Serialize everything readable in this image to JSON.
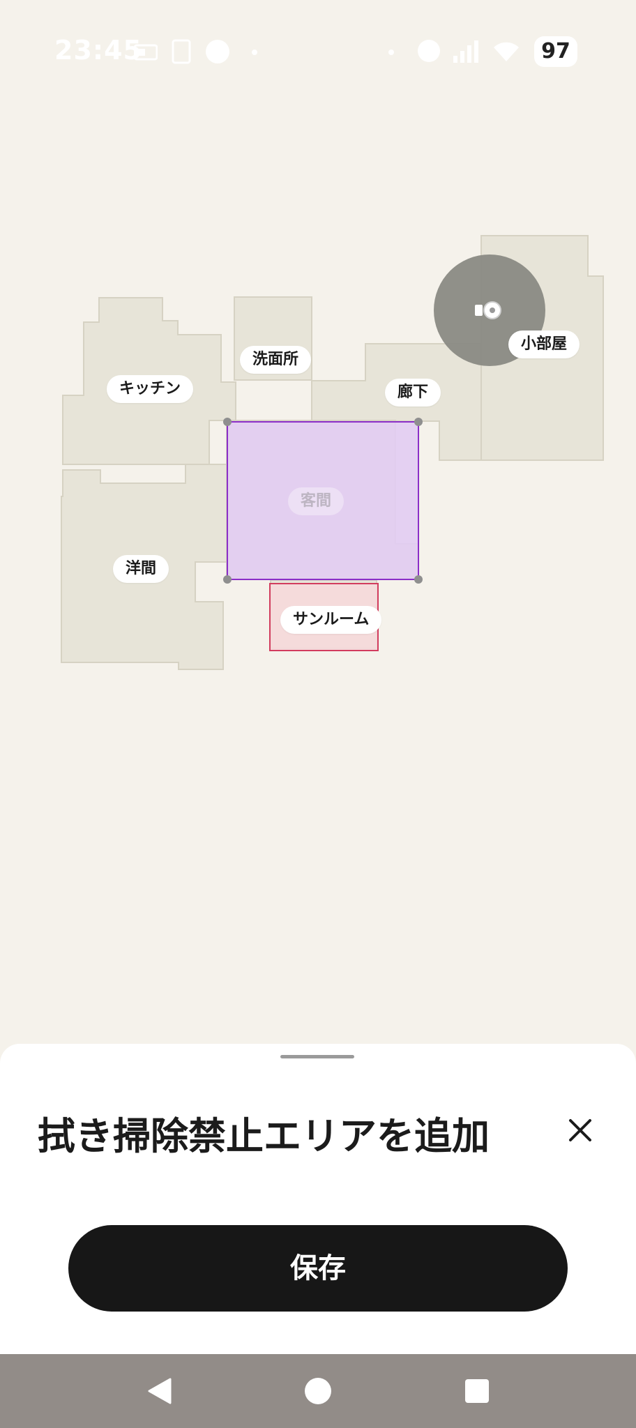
{
  "status_bar": {
    "time": "23:45",
    "battery": "97",
    "icons": [
      "sim-card-icon",
      "tablet-icon",
      "circle-app-icon",
      "dot-icon",
      "dot-icon",
      "minus-circle-icon",
      "signal-icon",
      "wifi-icon"
    ]
  },
  "map": {
    "rooms": {
      "kitchen": "キッチン",
      "washroom": "洗面所",
      "hallway": "廊下",
      "small_room": "小部屋",
      "guest_room": "客間",
      "western_room": "洋間",
      "sunroom": "サンルーム"
    },
    "colors": {
      "floor": "#e7e4d8",
      "floor_border": "#d6d2c3",
      "no_mop_zone_fill": "#e2ccf3",
      "no_mop_zone_border": "#8b2ec8",
      "no_go_zone_fill": "#f7d9dc",
      "no_go_zone_border": "#d23c5e",
      "robot_range": "#8a8a84"
    }
  },
  "sheet": {
    "title": "拭き掃除禁止エリアを追加",
    "close_icon": "close-icon",
    "save_label": "保存"
  },
  "nav_bar": {
    "icons": [
      "back-icon",
      "home-icon",
      "recents-icon"
    ]
  }
}
